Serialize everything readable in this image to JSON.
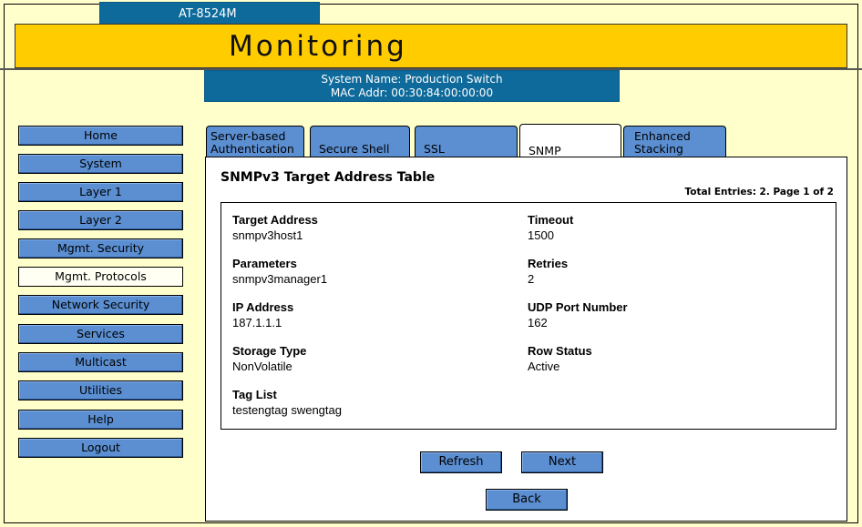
{
  "header": {
    "model": "AT-8524M",
    "title": "Monitoring",
    "system_name": "System Name: Production Switch",
    "mac_addr": "MAC Addr: 00:30:84:00:00:00"
  },
  "nav": {
    "items": [
      {
        "label": "Home"
      },
      {
        "label": "System"
      },
      {
        "label": "Layer 1"
      },
      {
        "label": "Layer 2"
      },
      {
        "label": "Mgmt. Security"
      },
      {
        "label": "Mgmt. Protocols",
        "active": true
      },
      {
        "label": "Network Security"
      },
      {
        "label": "Services"
      },
      {
        "label": "Multicast"
      },
      {
        "label": "Utilities"
      },
      {
        "label": "Help"
      },
      {
        "label": "Logout"
      }
    ]
  },
  "tabs": {
    "server_auth_line1": "Server-based",
    "server_auth_line2": "Authentication",
    "secure_shell": "Secure Shell",
    "ssl": "SSL",
    "snmp": "SNMP",
    "enhanced_line1": "Enhanced",
    "enhanced_line2": "Stacking",
    "selected": "SNMP"
  },
  "panel": {
    "title": "SNMPv3 Target Address Table",
    "total": "Total Entries: 2. Page 1 of 2"
  },
  "entry": {
    "target_address": {
      "label": "Target Address",
      "value": "snmpv3host1"
    },
    "parameters": {
      "label": "Parameters",
      "value": "snmpv3manager1"
    },
    "ip_address": {
      "label": "IP Address",
      "value": "187.1.1.1"
    },
    "storage_type": {
      "label": "Storage Type",
      "value": "NonVolatile"
    },
    "tag_list": {
      "label": "Tag List",
      "value": "testengtag swengtag"
    },
    "timeout": {
      "label": "Timeout",
      "value": "1500"
    },
    "retries": {
      "label": "Retries",
      "value": "2"
    },
    "udp_port": {
      "label": "UDP Port Number",
      "value": "162"
    },
    "row_status": {
      "label": "Row Status",
      "value": "Active"
    }
  },
  "buttons": {
    "refresh": "Refresh",
    "next": "Next",
    "back": "Back"
  },
  "colors": {
    "background": "#ffffcc",
    "banner": "#ffcc00",
    "info_bar": "#0e6a9a",
    "button": "#5b8fd2"
  }
}
